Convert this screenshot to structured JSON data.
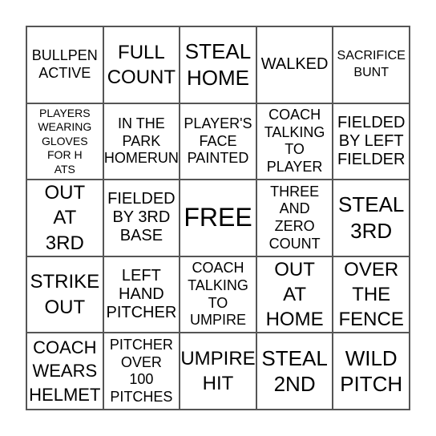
{
  "board": {
    "cells": [
      {
        "text": "BULLPEN\nACTIVE"
      },
      {
        "text": "FULL\nCOUNT"
      },
      {
        "text": "STEAL\nHOME"
      },
      {
        "text": "WALKED"
      },
      {
        "text": "SACRIFICE\nBUNT"
      },
      {
        "text": "PLAYERS\nWEARING\nGLOVES\nFOR H\nATS"
      },
      {
        "text": "IN THE\nPARK\nHOMERUN"
      },
      {
        "text": "PLAYER'S\nFACE\nPAINTED"
      },
      {
        "text": "COACH\nTALKING\nTO\nPLAYER"
      },
      {
        "text": "FIELDED\nBY LEFT\nFIELDER"
      },
      {
        "text": "OUT\nAT\n3RD"
      },
      {
        "text": "FIELDED\nBY 3RD\nBASE"
      },
      {
        "text": "FREE"
      },
      {
        "text": "THREE\nAND\nZERO\nCOUNT"
      },
      {
        "text": "STEAL\n3RD"
      },
      {
        "text": "STRIKE\nOUT"
      },
      {
        "text": "LEFT\nHAND\nPITCHER"
      },
      {
        "text": "COACH\nTALKING\nTO\nUMPIRE"
      },
      {
        "text": "OUT\nAT\nHOME"
      },
      {
        "text": "OVER\nTHE\nFENCE"
      },
      {
        "text": "COACH\nWEARS\nHELMET"
      },
      {
        "text": "PITCHER\nOVER\n100\nPITCHES"
      },
      {
        "text": "UMPIRE\nHIT"
      },
      {
        "text": "STEAL\n2ND"
      },
      {
        "text": "WILD\nPITCH"
      }
    ]
  }
}
